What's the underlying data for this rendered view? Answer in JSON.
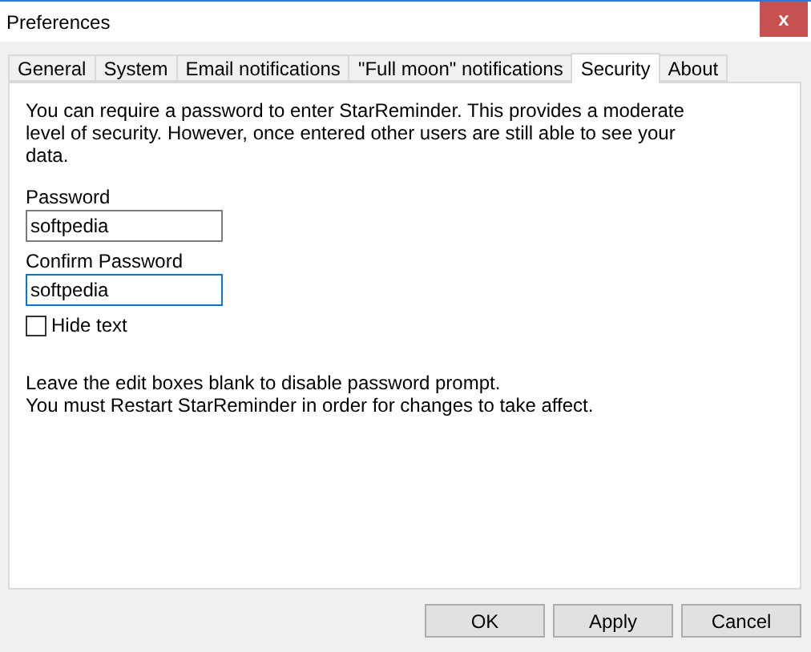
{
  "window": {
    "title": "Preferences",
    "close": "x"
  },
  "tabs": [
    {
      "label": "General",
      "selected": false
    },
    {
      "label": "System",
      "selected": false
    },
    {
      "label": "Email notifications",
      "selected": false
    },
    {
      "label": "\"Full moon\" notifications",
      "selected": false
    },
    {
      "label": "Security",
      "selected": true
    },
    {
      "label": "About",
      "selected": false
    }
  ],
  "intro": "You can require a password to enter StarReminder. This provides a moderate level of security. However, once entered other users are still able to see your data.",
  "fields": [
    {
      "label": "Password",
      "value": "softpedia",
      "focused": false
    },
    {
      "label": "Confirm Password",
      "value": "softpedia",
      "focused": true
    }
  ],
  "hide_text": {
    "label": "Hide text",
    "checked": false
  },
  "notes": [
    "Leave the edit boxes blank to disable password prompt.",
    "You must Restart StarReminder in order for changes to take affect."
  ],
  "buttons": [
    "OK",
    "Apply",
    "Cancel"
  ]
}
